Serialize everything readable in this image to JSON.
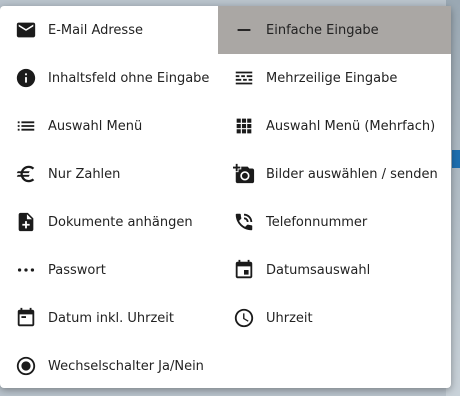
{
  "menu": {
    "items": [
      {
        "label": "E-Mail Adresse",
        "icon": "email-icon"
      },
      {
        "label": "Einfache Eingabe",
        "icon": "minus-icon",
        "selected": true
      },
      {
        "label": "Inhaltsfeld ohne Eingabe",
        "icon": "info-icon"
      },
      {
        "label": "Mehrzeilige Eingabe",
        "icon": "multiline-icon"
      },
      {
        "label": "Auswahl Menü",
        "icon": "list-icon"
      },
      {
        "label": "Auswahl Menü (Mehrfach)",
        "icon": "grid-icon"
      },
      {
        "label": "Nur Zahlen",
        "icon": "euro-icon"
      },
      {
        "label": "Bilder auswählen / senden",
        "icon": "add-camera-icon"
      },
      {
        "label": "Dokumente anhängen",
        "icon": "add-document-icon"
      },
      {
        "label": "Telefonnummer",
        "icon": "phone-icon"
      },
      {
        "label": "Passwort",
        "icon": "dots-icon"
      },
      {
        "label": "Datumsauswahl",
        "icon": "calendar-icon"
      },
      {
        "label": "Datum inkl. Uhrzeit",
        "icon": "calendar-outline-icon"
      },
      {
        "label": "Uhrzeit",
        "icon": "clock-icon"
      },
      {
        "label": "Wechselschalter Ja/Nein",
        "icon": "radio-icon"
      }
    ]
  },
  "colors": {
    "selected_bg": "#aaa7a4",
    "icon": "#1b1b1b"
  }
}
